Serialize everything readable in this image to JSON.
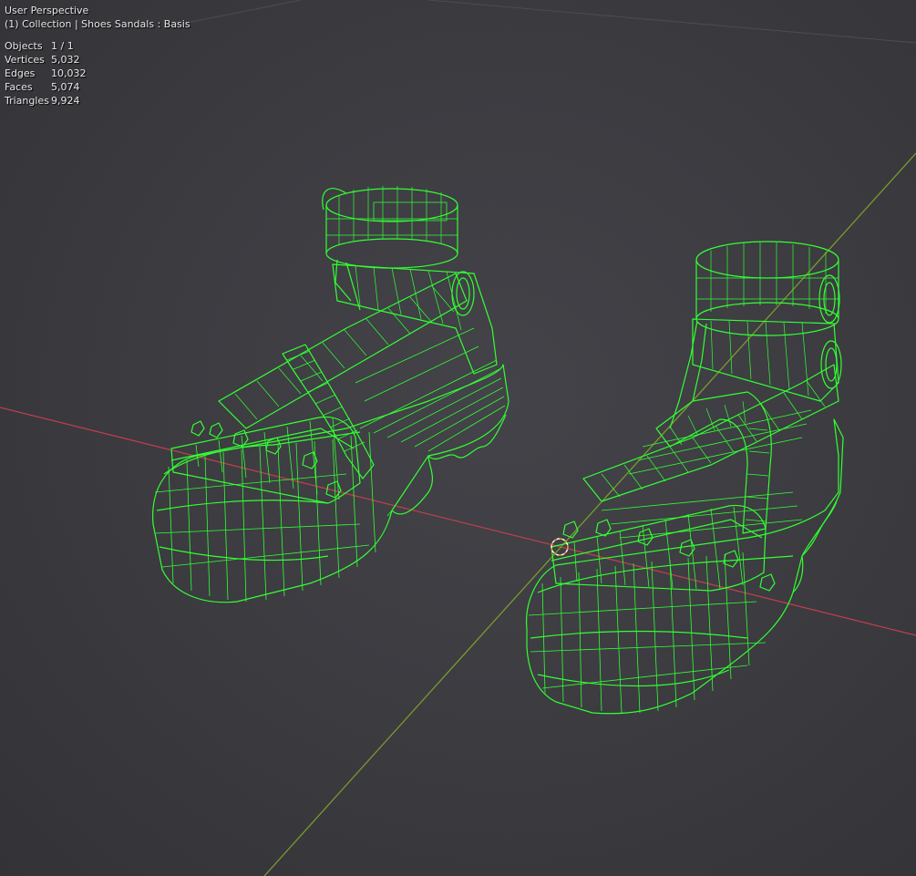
{
  "viewport": {
    "view_name": "User Perspective",
    "context_line": "(1) Collection | Shoes Sandals : Basis"
  },
  "stats": [
    {
      "label": "Objects",
      "value": "1 / 1"
    },
    {
      "label": "Vertices",
      "value": "5,032"
    },
    {
      "label": "Edges",
      "value": "10,032"
    },
    {
      "label": "Faces",
      "value": "5,074"
    },
    {
      "label": "Triangles",
      "value": "9,924"
    }
  ],
  "colors": {
    "background": "#3c3c41",
    "wireframe": "#33ff33",
    "x_axis": "#b8404a",
    "y_axis": "#7a9a2e",
    "grid": "#505056",
    "origin": "#e8a040"
  }
}
